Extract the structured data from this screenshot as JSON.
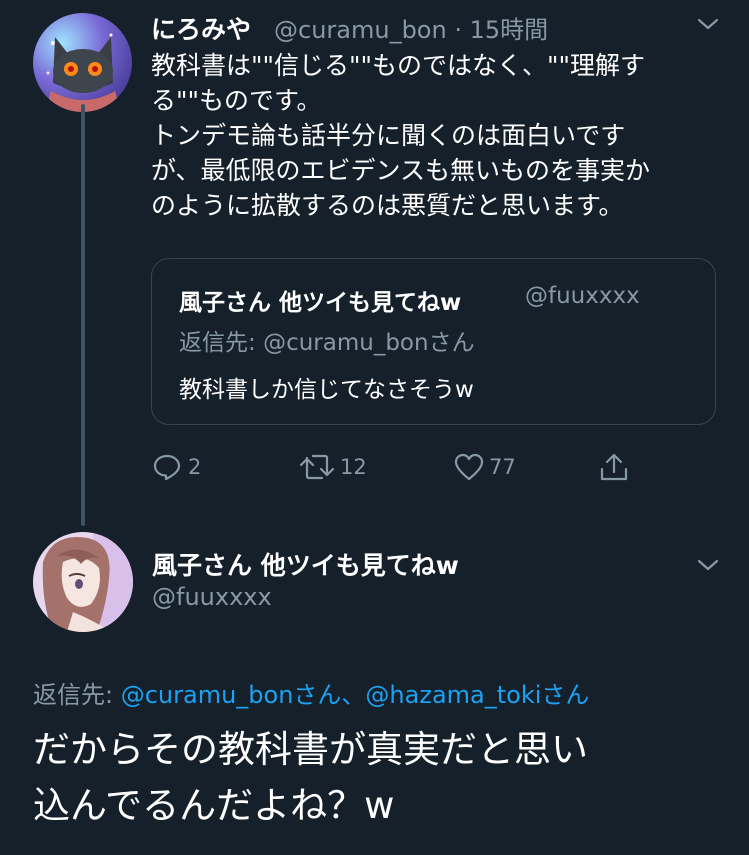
{
  "tweet1": {
    "display_name": "にろみや",
    "handle": "@curamu_bon",
    "separator": "·",
    "time": "15時間",
    "lines": [
      "教科書は\"\"信じる\"\"ものではなく、\"\"理解す",
      "る\"\"ものです。",
      "トンデモ論も話半分に聞くのは面白いです",
      "が、最低限のエビデンスも無いものを事実か",
      "のように拡散するのは悪質だと思います。"
    ],
    "quote": {
      "display_name": "風子さん 他ツイも見てねw",
      "handle": "@fuuxxxx",
      "reply_prefix": "返信先: ",
      "reply_to": "@curamu_bonさん",
      "text": "教科書しか信じてなさそうw"
    },
    "actions": {
      "reply_count": "2",
      "retweet_count": "12",
      "like_count": "77"
    }
  },
  "tweet2": {
    "display_name": "風子さん 他ツイも見てねw",
    "handle": "@fuuxxxx",
    "reply_prefix": "返信先: ",
    "reply_to_1": "@curamu_bonさん",
    "reply_sep": "、",
    "reply_to_2": "@hazama_tokiさん",
    "lines": [
      "だからその教科書が真実だと思い",
      "込んでるんだよね？w"
    ]
  },
  "colors": {
    "background": "#15202b",
    "muted": "#8899a6",
    "link": "#1da1f2",
    "border": "#38444d"
  }
}
